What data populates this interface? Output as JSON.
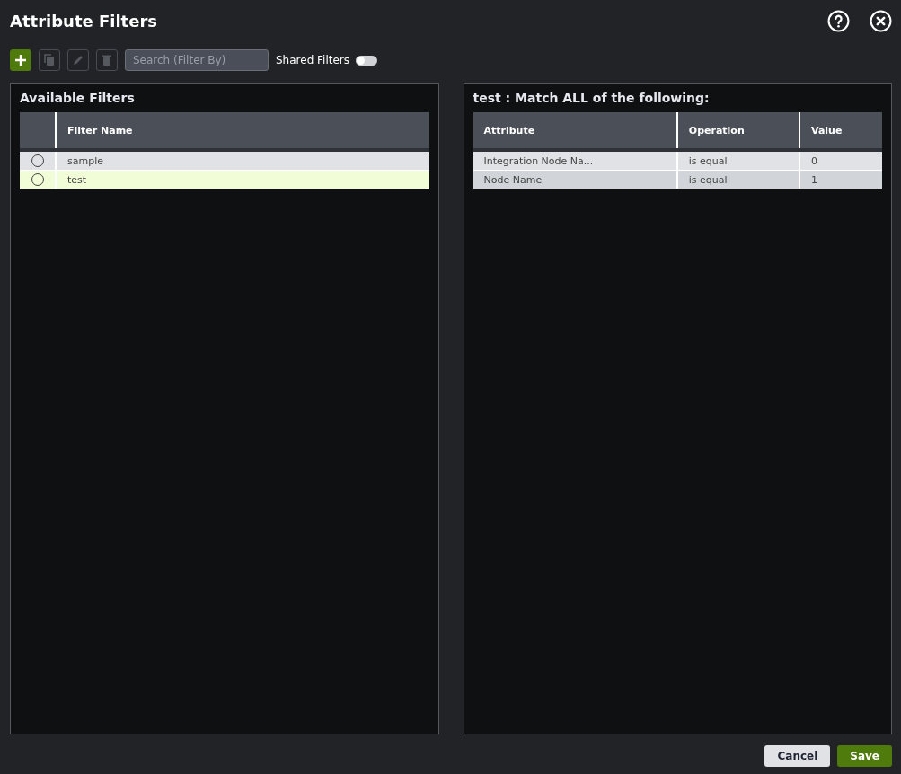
{
  "window": {
    "title": "Attribute Filters"
  },
  "toolbar": {
    "buttons": [
      {
        "kind": "add",
        "disabled": false
      },
      {
        "kind": "copy",
        "disabled": true
      },
      {
        "kind": "edit",
        "disabled": true
      },
      {
        "kind": "delete",
        "disabled": true
      }
    ],
    "search": {
      "placeholder": "Search (Filter By)"
    },
    "shared_toggle": {
      "label": "Shared Filters",
      "on": false
    }
  },
  "available": {
    "title": "Available Filters",
    "columns": [
      "Filter Name"
    ],
    "rows": [
      {
        "name": "sample",
        "selected": false,
        "checked": false
      },
      {
        "name": "test",
        "selected": true,
        "checked": false
      }
    ]
  },
  "details": {
    "title": "test : Match ALL of the following:",
    "columns": [
      "Attribute",
      "Operation",
      "Value"
    ],
    "rows": [
      [
        "Integration Node Na...",
        "is equal",
        "0"
      ],
      [
        "Node Name",
        "is equal",
        "1"
      ]
    ]
  },
  "buttons": [
    {
      "kind": "secondary",
      "label": "Cancel"
    },
    {
      "kind": "primary",
      "label": "Save"
    }
  ]
}
